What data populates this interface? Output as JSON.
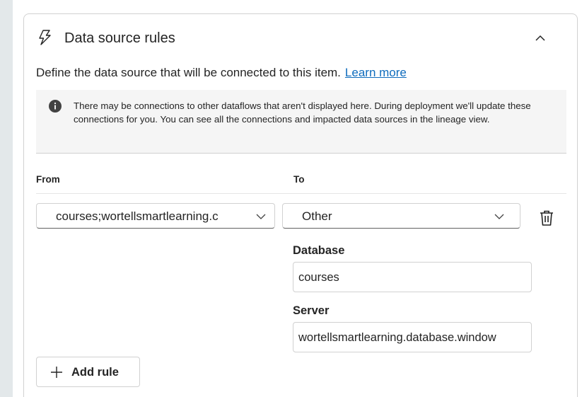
{
  "card": {
    "title": "Data source rules",
    "description": "Define the data source that will be connected to this item.",
    "learn_more": "Learn more"
  },
  "info": {
    "text": "There may be connections to other dataflows that aren't displayed here. During deployment we'll update these connections for you. You can see all the connections and impacted data sources in the lineage view."
  },
  "columns": {
    "from": "From",
    "to": "To"
  },
  "rule": {
    "from_value": "courses;wortellsmartlearning.c",
    "to_value": "Other",
    "database_label": "Database",
    "database_value": "courses",
    "server_label": "Server",
    "server_value": "wortellsmartlearning.database.window"
  },
  "add_rule_label": "Add rule",
  "icons": {
    "header": "lightning-bolt-icon",
    "collapse": "chevron-up-icon",
    "info": "info-icon",
    "dropdown": "chevron-down-icon",
    "delete": "trash-icon",
    "add": "plus-icon"
  },
  "colors": {
    "link": "#0f6cbd",
    "background": "#e3e8ea",
    "info_bar": "#f5f5f5"
  }
}
